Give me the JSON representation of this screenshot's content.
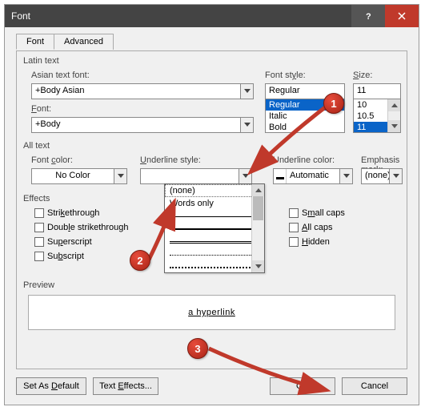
{
  "title": "Font",
  "tabs": {
    "font": "Font",
    "advanced": "Advanced"
  },
  "latin": {
    "group": "Latin text",
    "asian_label": "Asian text font:",
    "asian_value": "+Body Asian",
    "font_label": "Font:",
    "font_value": "+Body",
    "style_label": "Font style:",
    "style_value": "Regular",
    "style_list": [
      "Regular",
      "Italic",
      "Bold"
    ],
    "size_label": "Size:",
    "size_value": "11",
    "size_list": [
      "10",
      "10.5",
      "11"
    ]
  },
  "alltext": {
    "group": "All text",
    "color_label": "Font color:",
    "color_value": "No Color",
    "ustyle_label": "Underline style:",
    "ucolor_label": "Underline color:",
    "ucolor_value": "Automatic",
    "emph_label": "Emphasis mark:",
    "emph_value": "(none)"
  },
  "dropdown": {
    "none": "(none)",
    "words": "Words only"
  },
  "effects": {
    "group": "Effects",
    "strike": "Strikethrough",
    "dstrike": "Double strikethrough",
    "super": "Superscript",
    "sub": "Subscript",
    "small": "Small caps",
    "all": "All caps",
    "hidden": "Hidden"
  },
  "preview": {
    "label": "Preview",
    "text": "a hyperlink"
  },
  "buttons": {
    "default": "Set As Default",
    "effects": "Text Effects...",
    "ok": "OK",
    "cancel": "Cancel"
  },
  "markers": {
    "m1": "1",
    "m2": "2",
    "m3": "3"
  }
}
